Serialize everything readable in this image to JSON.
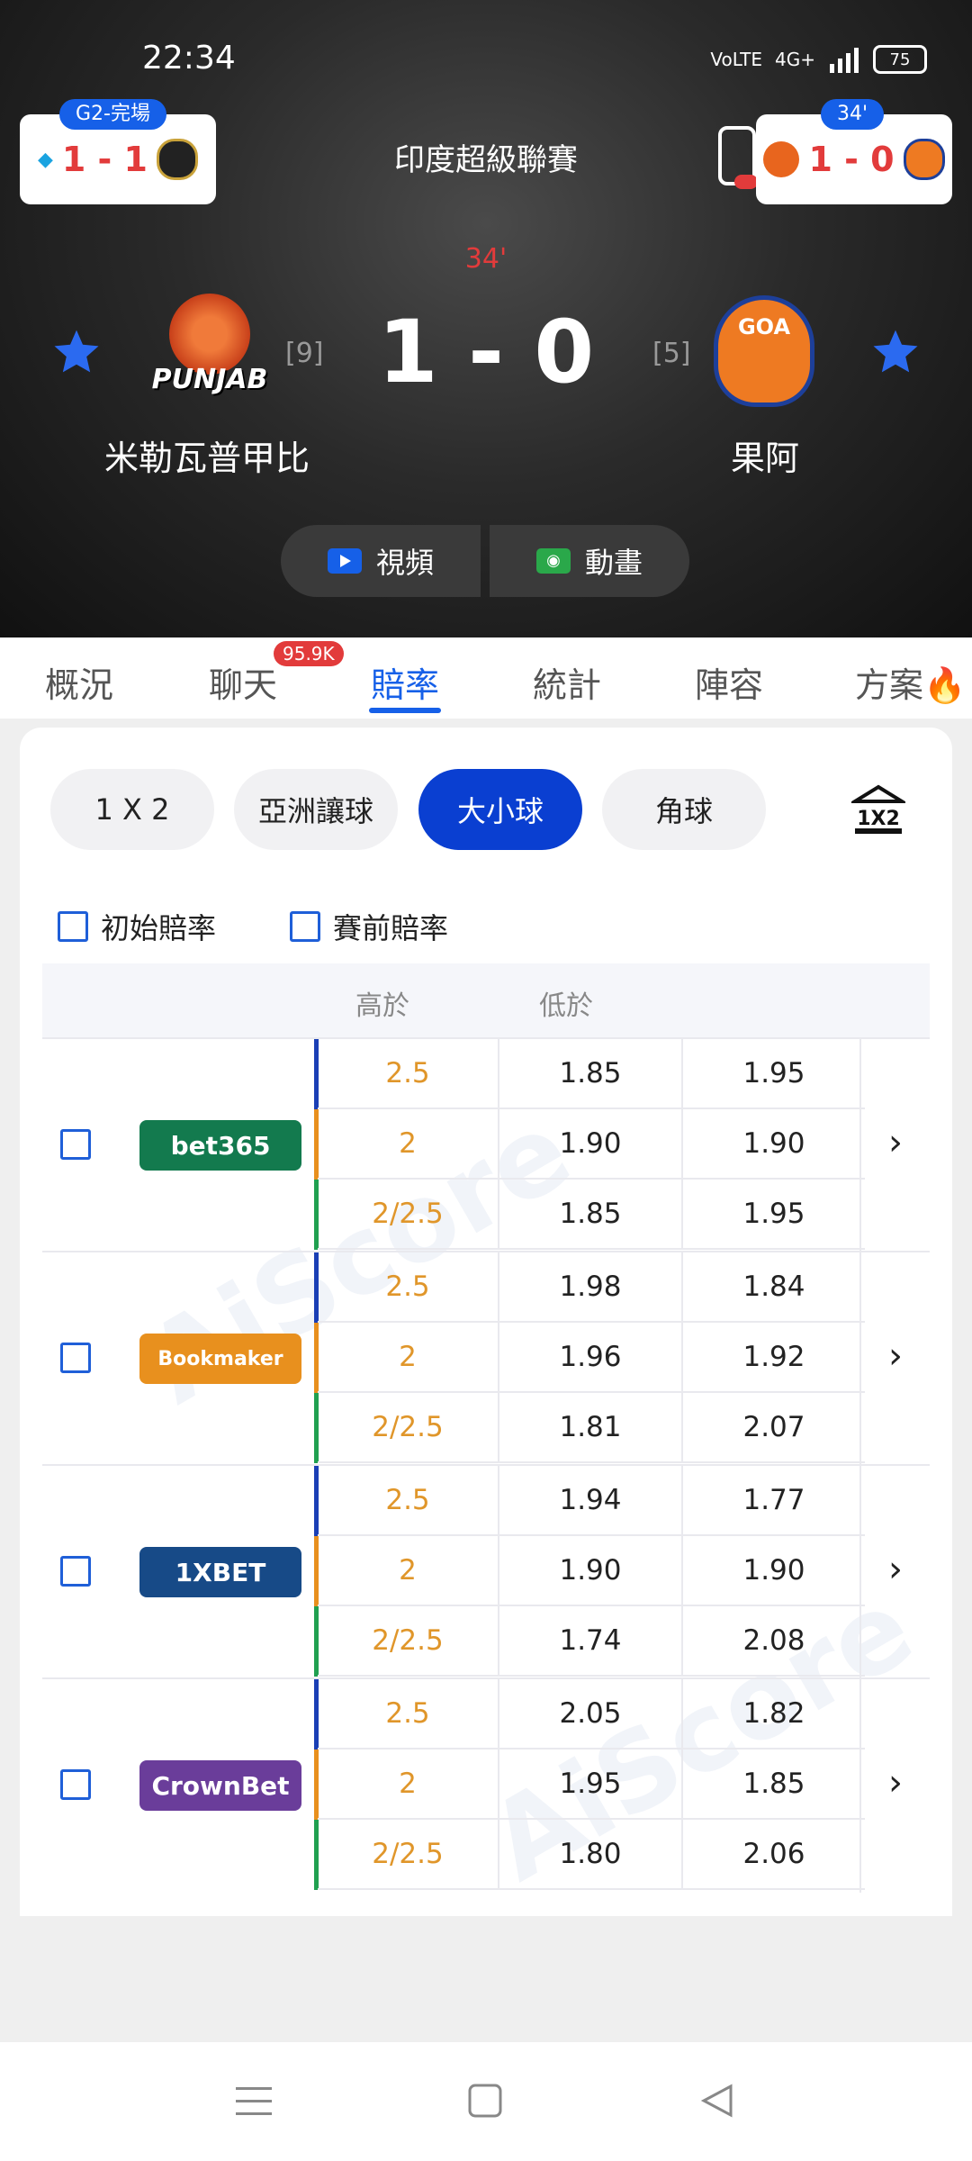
{
  "status": {
    "time": "22:34",
    "network": "4G+",
    "battery": "75"
  },
  "mini_left": {
    "badge": "G2-完場",
    "score": "1 - 1"
  },
  "mini_right": {
    "badge": "34'",
    "score": "1 - 0"
  },
  "match": {
    "league": "印度超級聯賽",
    "minute": "34'",
    "score": "1 - 0",
    "home": {
      "name": "米勒瓦普甲比",
      "rank": "[9]",
      "logo_text": "PUNJAB"
    },
    "away": {
      "name": "果阿",
      "rank": "[5]",
      "logo_text": "GOA"
    }
  },
  "media": {
    "video": "視頻",
    "animation": "動畫"
  },
  "tabs": [
    {
      "label": "概況"
    },
    {
      "label": "聊天",
      "badge": "95.9K"
    },
    {
      "label": "賠率"
    },
    {
      "label": "統計"
    },
    {
      "label": "陣容"
    },
    {
      "label": "方案"
    }
  ],
  "odds_types": [
    "1 X 2",
    "亞洲讓球",
    "大小球",
    "角球"
  ],
  "filters": {
    "initial": "初始賠率",
    "prematch": "賽前賠率"
  },
  "table_header": {
    "over": "高於",
    "under": "低於"
  },
  "bookmakers": [
    {
      "name": "bet365",
      "color": "#137a4e",
      "rows": [
        [
          "2.5",
          "1.85",
          "1.95"
        ],
        [
          "2",
          "1.90",
          "1.90"
        ],
        [
          "2/2.5",
          "1.85",
          "1.95"
        ]
      ]
    },
    {
      "name": "Bookmaker",
      "color": "#e8901e",
      "rows": [
        [
          "2.5",
          "1.98",
          "1.84"
        ],
        [
          "2",
          "1.96",
          "1.92"
        ],
        [
          "2/2.5",
          "1.81",
          "2.07"
        ]
      ]
    },
    {
      "name": "1XBET",
      "color": "#174a87",
      "rows": [
        [
          "2.5",
          "1.94",
          "1.77"
        ],
        [
          "2",
          "1.90",
          "1.90"
        ],
        [
          "2/2.5",
          "1.74",
          "2.08"
        ]
      ]
    },
    {
      "name": "CrownBet",
      "color": "#6a3d9a",
      "rows": [
        [
          "2.5",
          "2.05",
          "1.82"
        ],
        [
          "2",
          "1.95",
          "1.85"
        ],
        [
          "2/2.5",
          "1.80",
          "2.06"
        ]
      ]
    }
  ],
  "line_colors": [
    "#1a3fb5",
    "#e8901e",
    "#20a050"
  ],
  "watermark": "AiScore"
}
